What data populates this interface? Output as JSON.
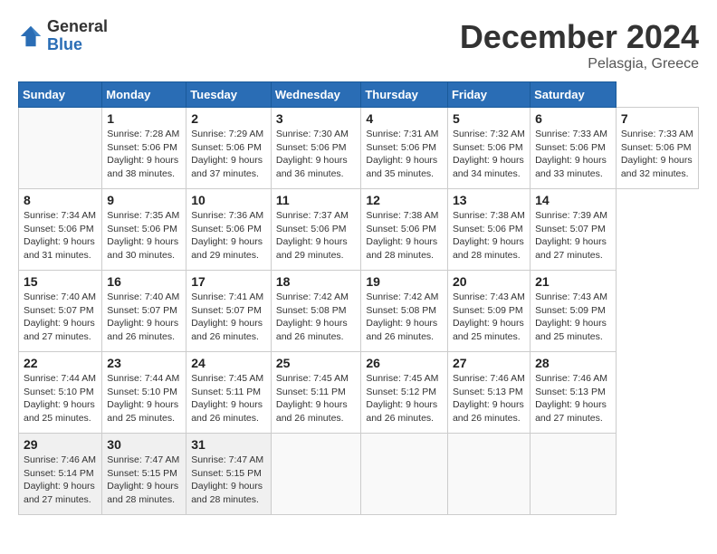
{
  "header": {
    "logo_general": "General",
    "logo_blue": "Blue",
    "month_title": "December 2024",
    "location": "Pelasgia, Greece"
  },
  "calendar": {
    "days_of_week": [
      "Sunday",
      "Monday",
      "Tuesday",
      "Wednesday",
      "Thursday",
      "Friday",
      "Saturday"
    ],
    "weeks": [
      [
        {
          "num": "",
          "info": ""
        },
        {
          "num": "1",
          "info": "Sunrise: 7:28 AM\nSunset: 5:06 PM\nDaylight: 9 hours\nand 38 minutes."
        },
        {
          "num": "2",
          "info": "Sunrise: 7:29 AM\nSunset: 5:06 PM\nDaylight: 9 hours\nand 37 minutes."
        },
        {
          "num": "3",
          "info": "Sunrise: 7:30 AM\nSunset: 5:06 PM\nDaylight: 9 hours\nand 36 minutes."
        },
        {
          "num": "4",
          "info": "Sunrise: 7:31 AM\nSunset: 5:06 PM\nDaylight: 9 hours\nand 35 minutes."
        },
        {
          "num": "5",
          "info": "Sunrise: 7:32 AM\nSunset: 5:06 PM\nDaylight: 9 hours\nand 34 minutes."
        },
        {
          "num": "6",
          "info": "Sunrise: 7:33 AM\nSunset: 5:06 PM\nDaylight: 9 hours\nand 33 minutes."
        },
        {
          "num": "7",
          "info": "Sunrise: 7:33 AM\nSunset: 5:06 PM\nDaylight: 9 hours\nand 32 minutes."
        }
      ],
      [
        {
          "num": "8",
          "info": "Sunrise: 7:34 AM\nSunset: 5:06 PM\nDaylight: 9 hours\nand 31 minutes."
        },
        {
          "num": "9",
          "info": "Sunrise: 7:35 AM\nSunset: 5:06 PM\nDaylight: 9 hours\nand 30 minutes."
        },
        {
          "num": "10",
          "info": "Sunrise: 7:36 AM\nSunset: 5:06 PM\nDaylight: 9 hours\nand 29 minutes."
        },
        {
          "num": "11",
          "info": "Sunrise: 7:37 AM\nSunset: 5:06 PM\nDaylight: 9 hours\nand 29 minutes."
        },
        {
          "num": "12",
          "info": "Sunrise: 7:38 AM\nSunset: 5:06 PM\nDaylight: 9 hours\nand 28 minutes."
        },
        {
          "num": "13",
          "info": "Sunrise: 7:38 AM\nSunset: 5:06 PM\nDaylight: 9 hours\nand 28 minutes."
        },
        {
          "num": "14",
          "info": "Sunrise: 7:39 AM\nSunset: 5:07 PM\nDaylight: 9 hours\nand 27 minutes."
        }
      ],
      [
        {
          "num": "15",
          "info": "Sunrise: 7:40 AM\nSunset: 5:07 PM\nDaylight: 9 hours\nand 27 minutes."
        },
        {
          "num": "16",
          "info": "Sunrise: 7:40 AM\nSunset: 5:07 PM\nDaylight: 9 hours\nand 26 minutes."
        },
        {
          "num": "17",
          "info": "Sunrise: 7:41 AM\nSunset: 5:07 PM\nDaylight: 9 hours\nand 26 minutes."
        },
        {
          "num": "18",
          "info": "Sunrise: 7:42 AM\nSunset: 5:08 PM\nDaylight: 9 hours\nand 26 minutes."
        },
        {
          "num": "19",
          "info": "Sunrise: 7:42 AM\nSunset: 5:08 PM\nDaylight: 9 hours\nand 26 minutes."
        },
        {
          "num": "20",
          "info": "Sunrise: 7:43 AM\nSunset: 5:09 PM\nDaylight: 9 hours\nand 25 minutes."
        },
        {
          "num": "21",
          "info": "Sunrise: 7:43 AM\nSunset: 5:09 PM\nDaylight: 9 hours\nand 25 minutes."
        }
      ],
      [
        {
          "num": "22",
          "info": "Sunrise: 7:44 AM\nSunset: 5:10 PM\nDaylight: 9 hours\nand 25 minutes."
        },
        {
          "num": "23",
          "info": "Sunrise: 7:44 AM\nSunset: 5:10 PM\nDaylight: 9 hours\nand 25 minutes."
        },
        {
          "num": "24",
          "info": "Sunrise: 7:45 AM\nSunset: 5:11 PM\nDaylight: 9 hours\nand 26 minutes."
        },
        {
          "num": "25",
          "info": "Sunrise: 7:45 AM\nSunset: 5:11 PM\nDaylight: 9 hours\nand 26 minutes."
        },
        {
          "num": "26",
          "info": "Sunrise: 7:45 AM\nSunset: 5:12 PM\nDaylight: 9 hours\nand 26 minutes."
        },
        {
          "num": "27",
          "info": "Sunrise: 7:46 AM\nSunset: 5:13 PM\nDaylight: 9 hours\nand 26 minutes."
        },
        {
          "num": "28",
          "info": "Sunrise: 7:46 AM\nSunset: 5:13 PM\nDaylight: 9 hours\nand 27 minutes."
        }
      ],
      [
        {
          "num": "29",
          "info": "Sunrise: 7:46 AM\nSunset: 5:14 PM\nDaylight: 9 hours\nand 27 minutes."
        },
        {
          "num": "30",
          "info": "Sunrise: 7:47 AM\nSunset: 5:15 PM\nDaylight: 9 hours\nand 28 minutes."
        },
        {
          "num": "31",
          "info": "Sunrise: 7:47 AM\nSunset: 5:15 PM\nDaylight: 9 hours\nand 28 minutes."
        },
        {
          "num": "",
          "info": ""
        },
        {
          "num": "",
          "info": ""
        },
        {
          "num": "",
          "info": ""
        },
        {
          "num": "",
          "info": ""
        }
      ]
    ]
  }
}
